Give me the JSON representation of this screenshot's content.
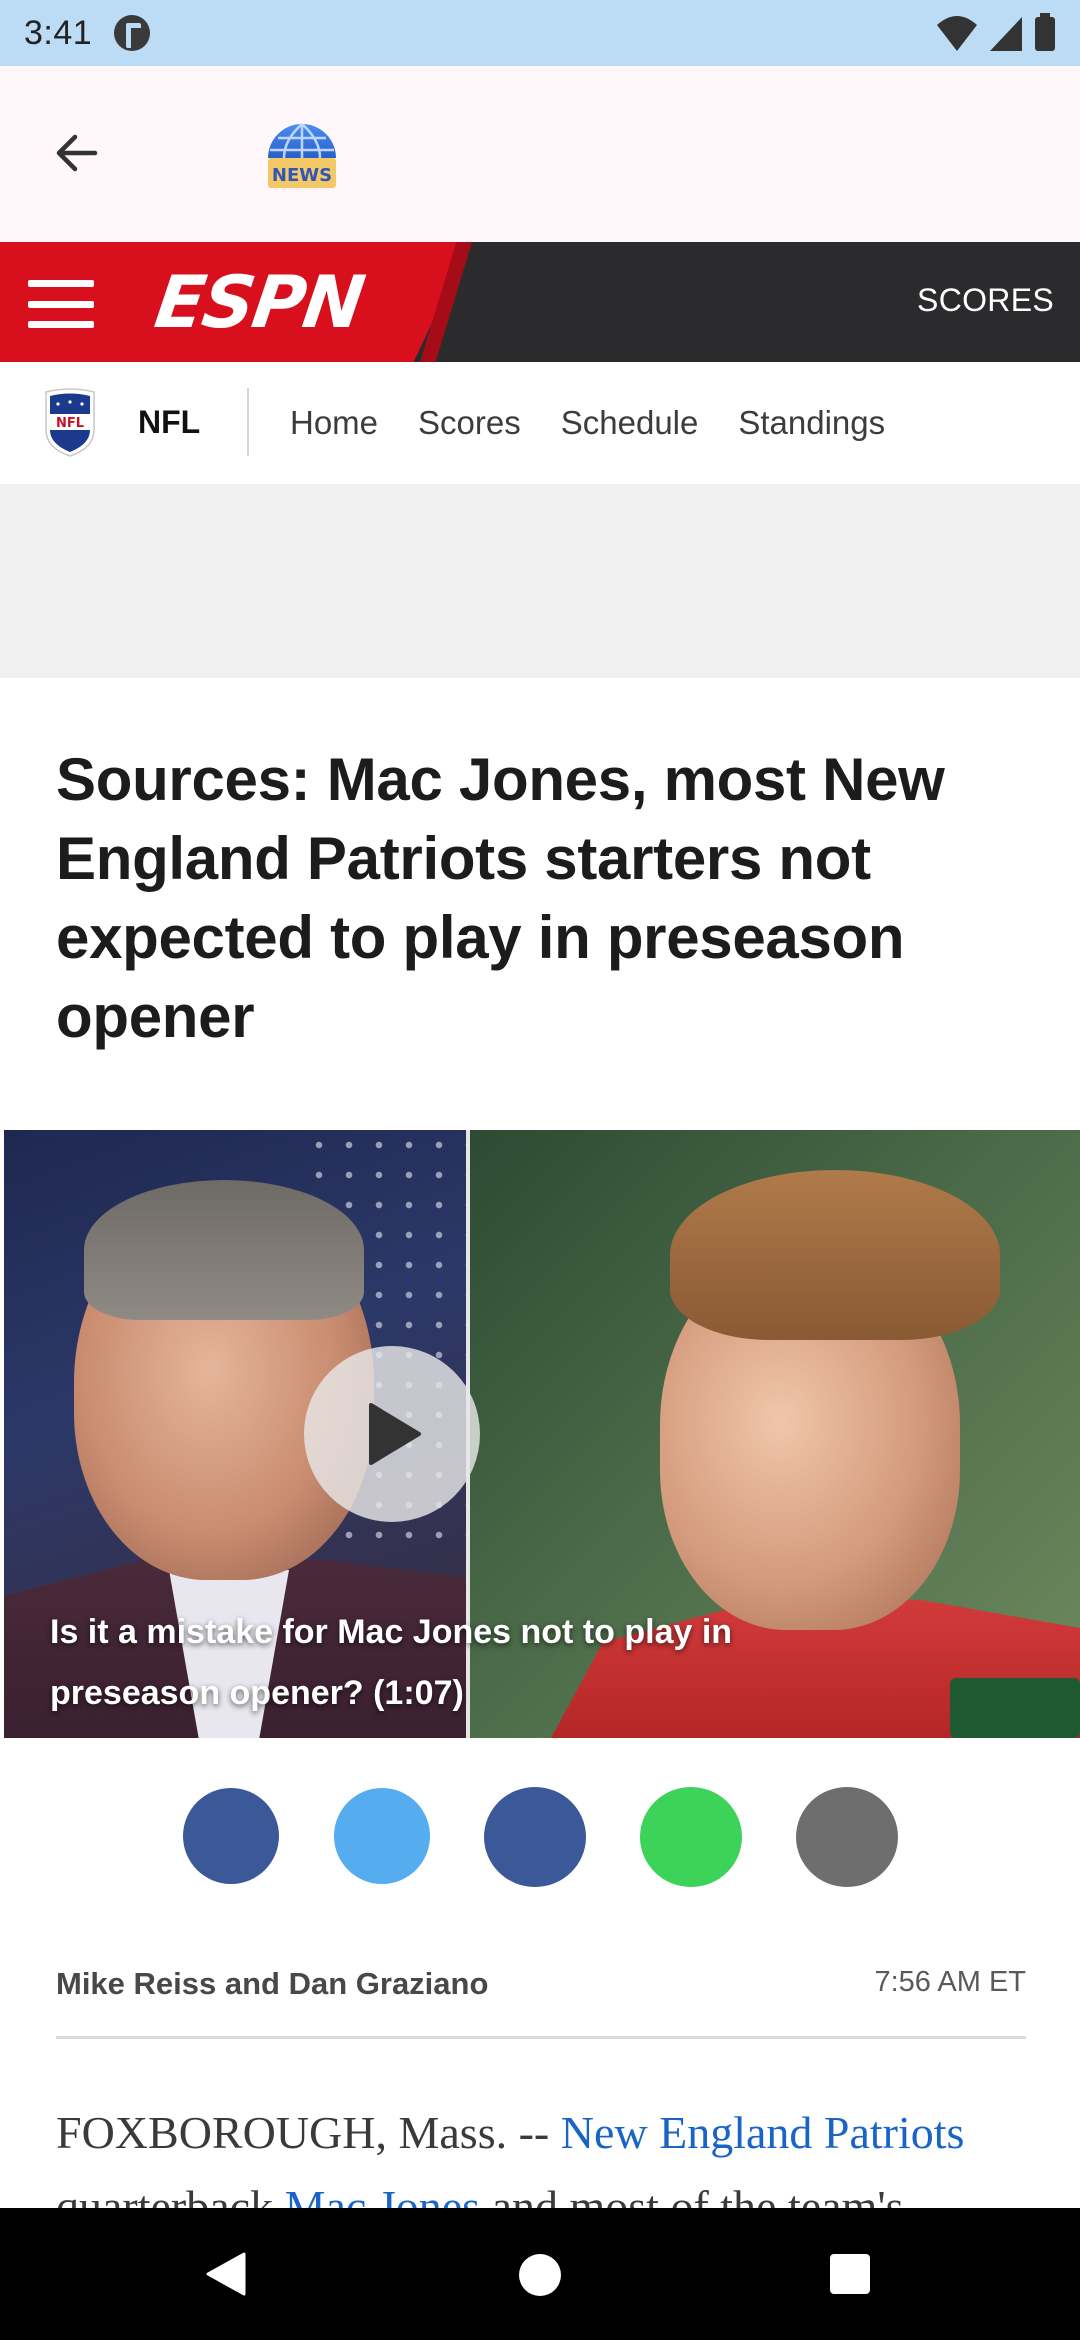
{
  "status_bar": {
    "time": "3:41"
  },
  "header": {
    "back_icon": "arrow-back-icon",
    "logo_text": "NEWS"
  },
  "espn_bar": {
    "logo": "ESPN",
    "scores_label": "SCORES"
  },
  "sub_nav": {
    "league": "NFL",
    "tabs": [
      {
        "label": "Home"
      },
      {
        "label": "Scores"
      },
      {
        "label": "Schedule"
      },
      {
        "label": "Standings"
      }
    ]
  },
  "article": {
    "headline": "Sources: Mac Jones, most New England Patriots starters not expected to play in preseason opener",
    "video": {
      "caption": "Is it a mistake for Mac Jones not to play in preseason opener? (1:07)"
    },
    "share": [
      {
        "name": "facebook",
        "color": "#3b5998"
      },
      {
        "name": "twitter",
        "color": "#55acee"
      },
      {
        "name": "messenger",
        "color": "#3b5998"
      },
      {
        "name": "whatsapp",
        "color": "#3dd35a"
      },
      {
        "name": "email",
        "color": "#6e6e6e"
      }
    ],
    "byline": "Mike Reiss and Dan Graziano",
    "timestamp": "7:56 AM ET",
    "body": {
      "dateline": "FOXBOROUGH, Mass. -- ",
      "link1": "New England Patriots",
      "text2": " quarterback ",
      "link2": "Mac Jones",
      "text3": " and most of the team's"
    }
  },
  "colors": {
    "espn_red": "#d8101e",
    "espn_dark": "#2b2b2d",
    "link_blue": "#1a64c8",
    "status_bar": "#bcdcf5"
  }
}
